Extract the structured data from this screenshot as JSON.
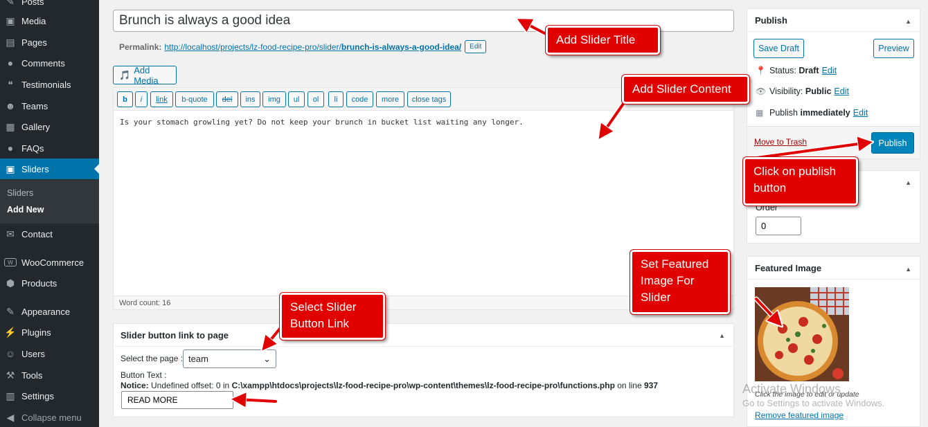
{
  "sidebar": {
    "items": [
      {
        "label": "Posts",
        "icon": "pushpin-icon"
      },
      {
        "label": "Media",
        "icon": "media-icon"
      },
      {
        "label": "Pages",
        "icon": "pages-icon"
      },
      {
        "label": "Comments",
        "icon": "comment-icon"
      },
      {
        "label": "Testimonials",
        "icon": "testimonial-icon"
      },
      {
        "label": "Teams",
        "icon": "team-icon"
      },
      {
        "label": "Gallery",
        "icon": "gallery-icon"
      },
      {
        "label": "FAQs",
        "icon": "faq-icon"
      },
      {
        "label": "Sliders",
        "icon": "slider-icon"
      },
      {
        "label": "Contact",
        "icon": "mail-icon"
      },
      {
        "label": "WooCommerce",
        "icon": "woocommerce-icon"
      },
      {
        "label": "Products",
        "icon": "products-icon"
      },
      {
        "label": "Appearance",
        "icon": "brush-icon"
      },
      {
        "label": "Plugins",
        "icon": "plugin-icon"
      },
      {
        "label": "Users",
        "icon": "user-icon"
      },
      {
        "label": "Tools",
        "icon": "wrench-icon"
      },
      {
        "label": "Settings",
        "icon": "settings-icon"
      },
      {
        "label": "Collapse menu",
        "icon": "collapse-icon"
      }
    ],
    "submenu": {
      "sliders": "Sliders",
      "add_new": "Add New"
    }
  },
  "editor": {
    "title_value": "Brunch is always a good idea",
    "permalink_label": "Permalink:",
    "permalink_base": "http://localhost/projects/lz-food-recipe-pro/slider/",
    "permalink_slug": "brunch-is-always-a-good-idea/",
    "edit_label": "Edit",
    "add_media_label": "Add Media",
    "toolbar": [
      "b",
      "i",
      "link",
      "b-quote",
      "del",
      "ins",
      "img",
      "ul",
      "ol",
      "li",
      "code",
      "more",
      "close tags"
    ],
    "content": "Is your stomach growling yet? Do not keep your brunch in bucket list waiting any longer.",
    "word_count": "Word count: 16"
  },
  "slider_box": {
    "title": "Slider button link to page",
    "select_label": "Select the page :",
    "selected_page": "team",
    "button_text_label": "Button Text :",
    "notice_label": "Notice:",
    "notice_pre": "Undefined offset: 0 in",
    "notice_path": "C:\\xampp\\htdocs\\projects\\lz-food-recipe-pro\\wp-content\\themes\\lz-food-recipe-pro\\functions.php",
    "notice_on_line": "on line",
    "notice_line": "937",
    "button_text_value": "READ MORE"
  },
  "publish": {
    "title": "Publish",
    "save_draft": "Save Draft",
    "preview": "Preview",
    "status_label": "Status:",
    "status_value": "Draft",
    "visibility_label": "Visibility:",
    "visibility_value": "Public",
    "publish_label": "Publish",
    "publish_value": "immediately",
    "edit_label": "Edit",
    "trash_label": "Move to Trash",
    "publish_button": "Publish"
  },
  "order_box": {
    "label": "Order",
    "value": "0"
  },
  "featured": {
    "title": "Featured Image",
    "caption": "Click the image to edit or update",
    "remove": "Remove featured image"
  },
  "watermark": {
    "line1": "Activate Windows",
    "line2": "Go to Settings to activate Windows."
  },
  "callouts": {
    "title": "Add Slider Title",
    "content": "Add Slider Content",
    "publish": "Click on publish button",
    "featured": "Set Featured Image For Slider",
    "link": "Select Slider Button Link"
  },
  "colors": {
    "accent": "#0073aa",
    "publish": "#0085ba",
    "sidebar": "#23282d",
    "callout": "#e10000"
  }
}
